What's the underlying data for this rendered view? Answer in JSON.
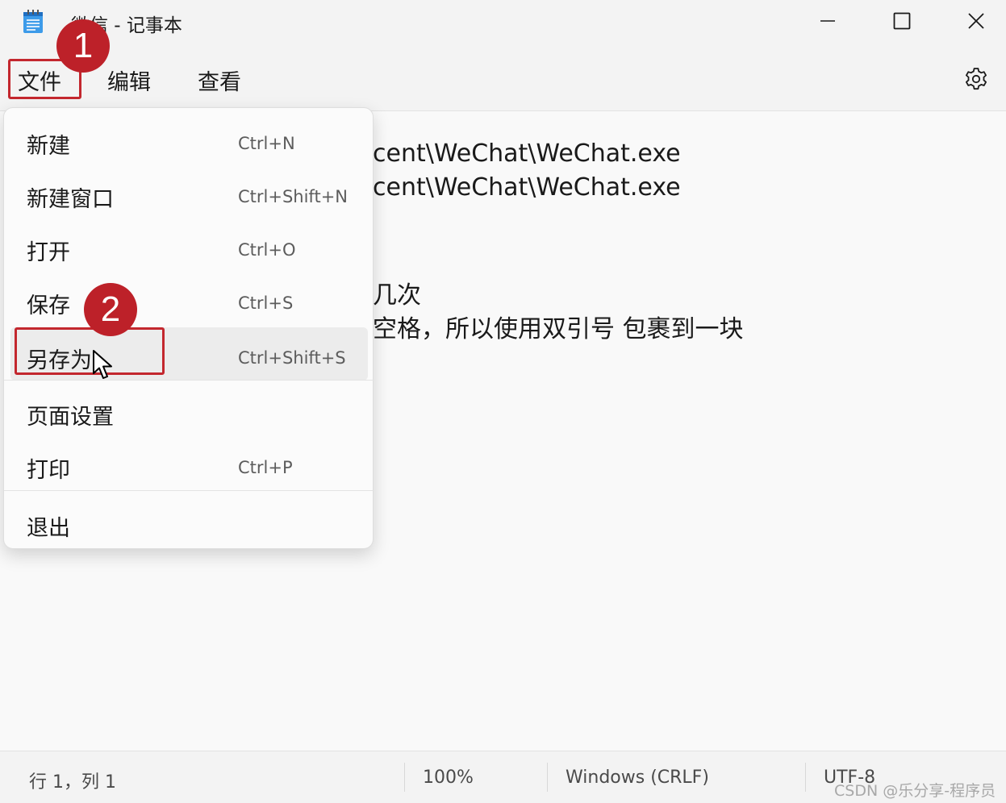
{
  "window": {
    "title": "微信 - 记事本",
    "app_icon": "notepad-icon"
  },
  "window_controls": {
    "minimize": "minimize-icon",
    "maximize": "maximize-icon",
    "close": "close-icon"
  },
  "menubar": {
    "items": [
      {
        "label": "文件"
      },
      {
        "label": "编辑"
      },
      {
        "label": "查看"
      }
    ],
    "settings_icon": "gear-icon"
  },
  "editor": {
    "lines": [
      "cent\\WeChat\\WeChat.exe",
      "cent\\WeChat\\WeChat.exe",
      "几次",
      "空格，所以使用双引号 包裹到一块"
    ]
  },
  "file_menu": {
    "items": [
      {
        "label": "新建",
        "shortcut": "Ctrl+N"
      },
      {
        "label": "新建窗口",
        "shortcut": "Ctrl+Shift+N"
      },
      {
        "label": "打开",
        "shortcut": "Ctrl+O"
      },
      {
        "label": "保存",
        "shortcut": "Ctrl+S"
      },
      {
        "label": "另存为",
        "shortcut": "Ctrl+Shift+S"
      },
      {
        "label": "页面设置",
        "shortcut": ""
      },
      {
        "label": "打印",
        "shortcut": "Ctrl+P"
      },
      {
        "label": "退出",
        "shortcut": ""
      }
    ],
    "hovered_index": 4
  },
  "statusbar": {
    "position": "行 1，列 1",
    "zoom": "100%",
    "line_ending": "Windows (CRLF)",
    "encoding": "UTF-8"
  },
  "annotations": {
    "step1": "1",
    "step2": "2",
    "highlight_color": "#c3272e",
    "badge_color": "#bd2129",
    "watermark": "CSDN @乐分享-程序员"
  }
}
